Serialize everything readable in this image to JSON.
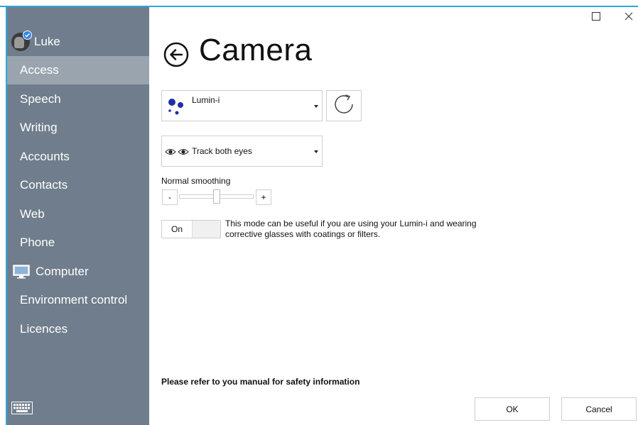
{
  "user": {
    "name": "Luke"
  },
  "sidebar": {
    "items": [
      {
        "label": "Access",
        "active": true
      },
      {
        "label": "Speech"
      },
      {
        "label": "Writing"
      },
      {
        "label": "Accounts"
      },
      {
        "label": "Contacts"
      },
      {
        "label": "Web"
      },
      {
        "label": "Phone"
      },
      {
        "label": "Computer",
        "icon": "monitor-icon"
      },
      {
        "label": "Environment control"
      },
      {
        "label": "Licences"
      }
    ],
    "footer_icon": "keyboard-icon"
  },
  "window": {
    "maximize_icon": "maximize-icon",
    "close_icon": "close-icon"
  },
  "page": {
    "title": "Camera",
    "back_icon": "back-arrow-icon"
  },
  "device_select": {
    "value": "Lumin-i",
    "icon": "lumin-dots-icon"
  },
  "refresh": {
    "icon": "refresh-icon"
  },
  "tracking_select": {
    "value": "Track both eyes",
    "icon": "eyes-icon"
  },
  "smoothing": {
    "label": "Normal smoothing",
    "minus": "-",
    "plus": "+",
    "level": 0.5
  },
  "mode_toggle": {
    "state": "On",
    "description": "This mode can be useful if you are using your Lumin-i and wearing corrective glasses with coatings or filters."
  },
  "safety_note": "Please refer to you manual for safety information",
  "buttons": {
    "ok": "OK",
    "cancel": "Cancel"
  },
  "colors": {
    "sidebar": "#6f7d8c",
    "sidebar_active": "#9aa4ae",
    "accent": "#2fa7d8",
    "dots": "#1f2fa8"
  }
}
